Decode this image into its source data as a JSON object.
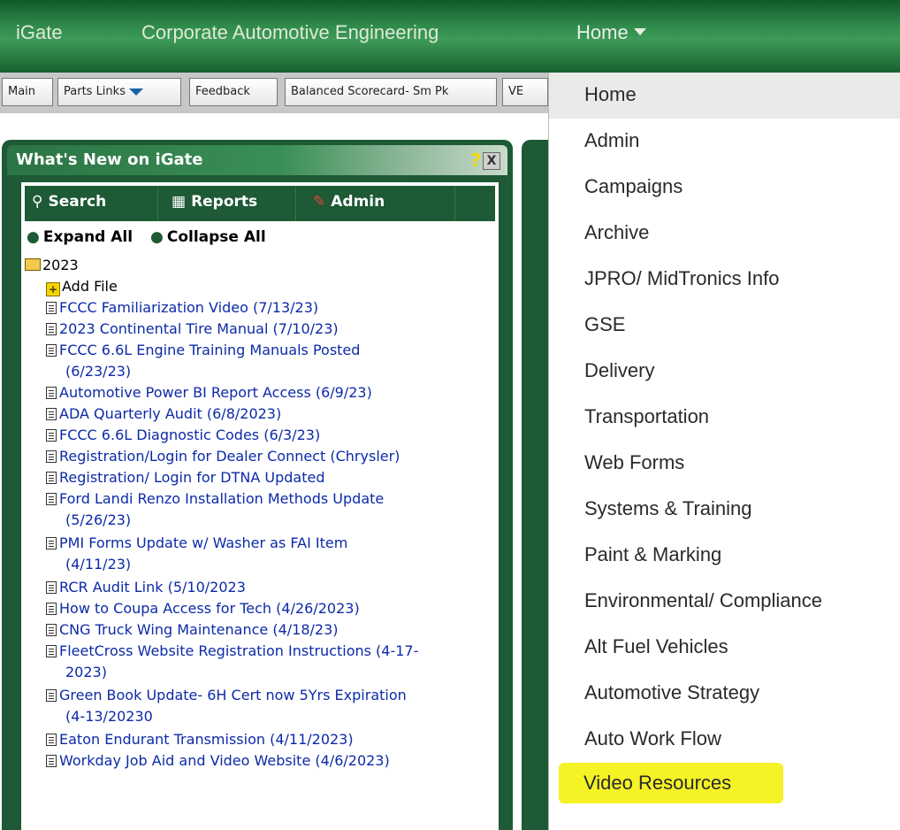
{
  "header": {
    "logo": "iGate",
    "site": "Corporate Automotive Engineering",
    "nav_home": "Home"
  },
  "toolbar": {
    "buttons": [
      "Main",
      "Parts Links",
      "Feedback",
      "Balanced Scorecard- Sm Pk",
      "VE"
    ]
  },
  "portlet": {
    "title": "What's New on iGate",
    "help_icon": "?",
    "close_icon": "X",
    "tools": {
      "search": "Search",
      "reports": "Reports",
      "admin": "Admin"
    },
    "expand_all": "Expand All",
    "collapse_all": "Collapse All",
    "year": "2023",
    "add_file": "Add File",
    "items": [
      "FCCC Familiarization Video (7/13/23)",
      "2023 Continental Tire Manual (7/10/23)",
      "FCCC 6.6L Engine Training Manuals Posted",
      "(6/23/23)",
      "Automotive Power BI Report Access (6/9/23)",
      "ADA Quarterly Audit (6/8/2023)",
      "FCCC 6.6L Diagnostic Codes (6/3/23)",
      "Registration/Login for Dealer Connect (Chrysler)",
      "Registration/ Login for DTNA Updated",
      "Ford Landi Renzo Installation Methods Update",
      "(5/26/23)",
      "PMI Forms Update w/ Washer as FAI Item",
      "(4/11/23)",
      "RCR Audit Link (5/10/2023",
      "How to Coupa Access for Tech (4/26/2023)",
      "CNG Truck Wing Maintenance (4/18/23)",
      "FleetCross Website Registration Instructions (4-17-",
      "2023)",
      "Green Book Update- 6H Cert now 5Yrs Expiration",
      "(4-13/20230",
      "Eaton Endurant Transmission (4/11/2023)",
      "Workday Job Aid and Video Website (4/6/2023)"
    ]
  },
  "menu": {
    "items": [
      "Home",
      "Admin",
      "Campaigns",
      "Archive",
      "JPRO/ MidTronics Info",
      "GSE",
      "Delivery",
      "Transportation",
      "Web Forms",
      "Systems & Training",
      "Paint & Marking",
      "Environmental/ Compliance",
      "Alt Fuel Vehicles",
      "Automotive Strategy",
      "Auto Work Flow",
      "Video Resources"
    ],
    "active_item": "Home",
    "highlighted_item": "Video Resources",
    "highlight_color": "#f4f11a"
  }
}
